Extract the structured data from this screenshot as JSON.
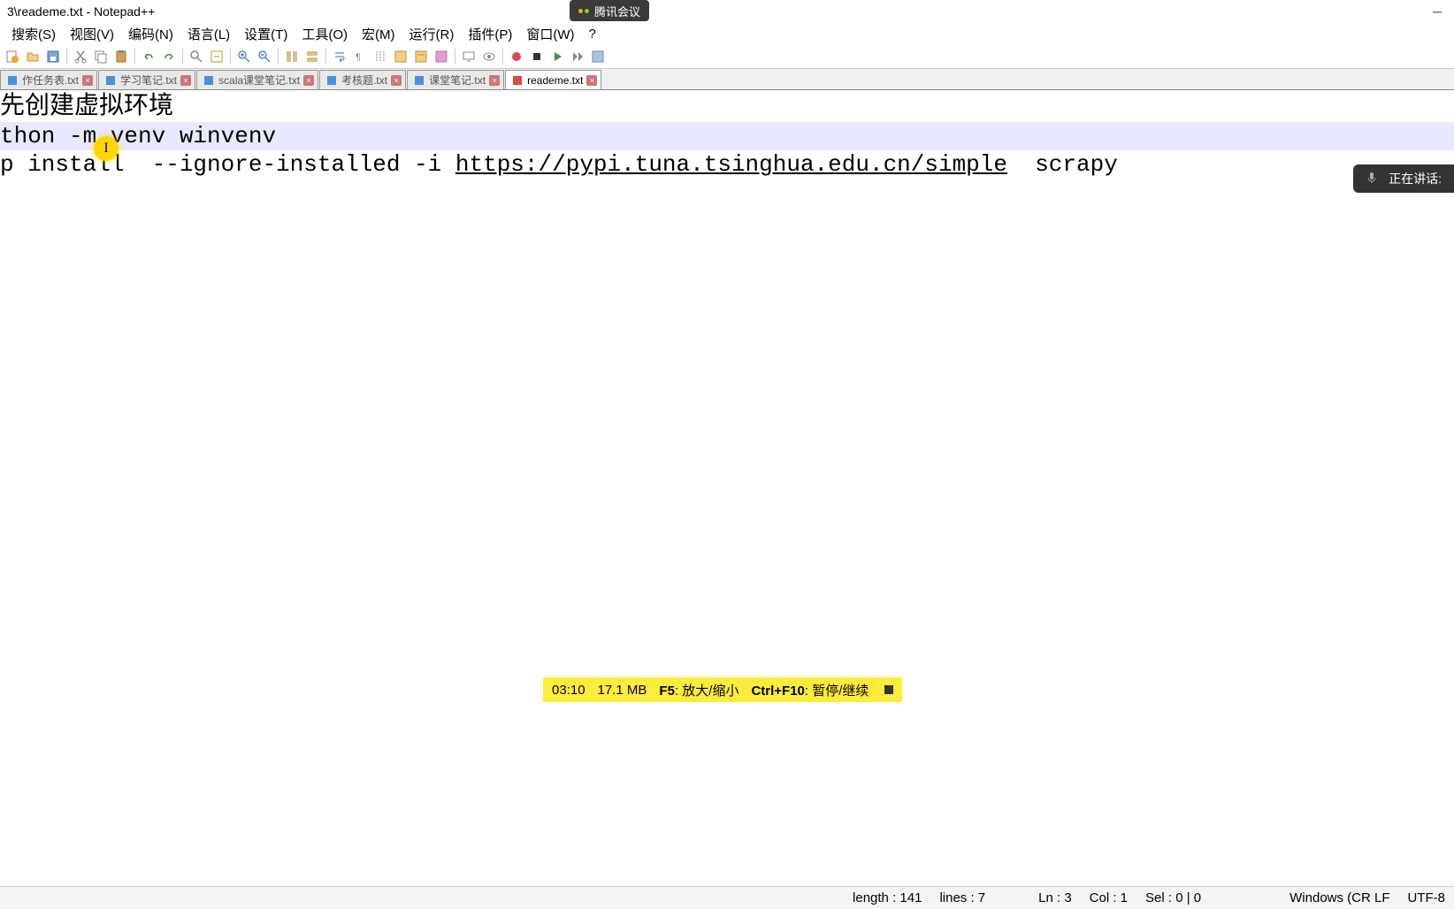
{
  "window": {
    "title": "3\\reademe.txt - Notepad++"
  },
  "overlay_badge": {
    "text": "腾讯会议"
  },
  "menubar": [
    "搜索(S)",
    "视图(V)",
    "编码(N)",
    "语言(L)",
    "设置(T)",
    "工具(O)",
    "宏(M)",
    "运行(R)",
    "插件(P)",
    "窗口(W)",
    "?"
  ],
  "tabs": [
    {
      "label": "作任务表.txt",
      "icon_color": "#4a90d9",
      "active": false
    },
    {
      "label": "学习笔记.txt",
      "icon_color": "#4a90d9",
      "active": false
    },
    {
      "label": "scala课堂笔记.txt",
      "icon_color": "#4a90d9",
      "active": false
    },
    {
      "label": "考核题.txt",
      "icon_color": "#4a90d9",
      "active": false
    },
    {
      "label": "课堂笔记.txt",
      "icon_color": "#4a90d9",
      "active": false
    },
    {
      "label": "reademe.txt",
      "icon_color": "#d94a4a",
      "active": true
    }
  ],
  "editor": {
    "line1": "先创建虚拟环境",
    "line2": "",
    "line3": "thon -m venv winvenv",
    "line4": "",
    "line5": "",
    "line6_pre": "p install  --ignore-installed -i ",
    "line6_link": "https://pypi.tuna.tsinghua.edu.cn/simple",
    "line6_post": "  scrapy"
  },
  "speaking_overlay": {
    "label": "正在讲话:"
  },
  "video_bar": {
    "time": "03:10",
    "memory": "17.1 MB",
    "key1_code": "F5",
    "key1_label": ": 放大/缩小",
    "key2_code": "Ctrl+F10",
    "key2_label": ": 暂停/继续"
  },
  "statusbar": {
    "length": "length : 141",
    "lines": "lines : 7",
    "ln": "Ln : 3",
    "col": "Col : 1",
    "sel": "Sel : 0 | 0",
    "eol": "Windows (CR LF",
    "encoding": "UTF-8"
  }
}
